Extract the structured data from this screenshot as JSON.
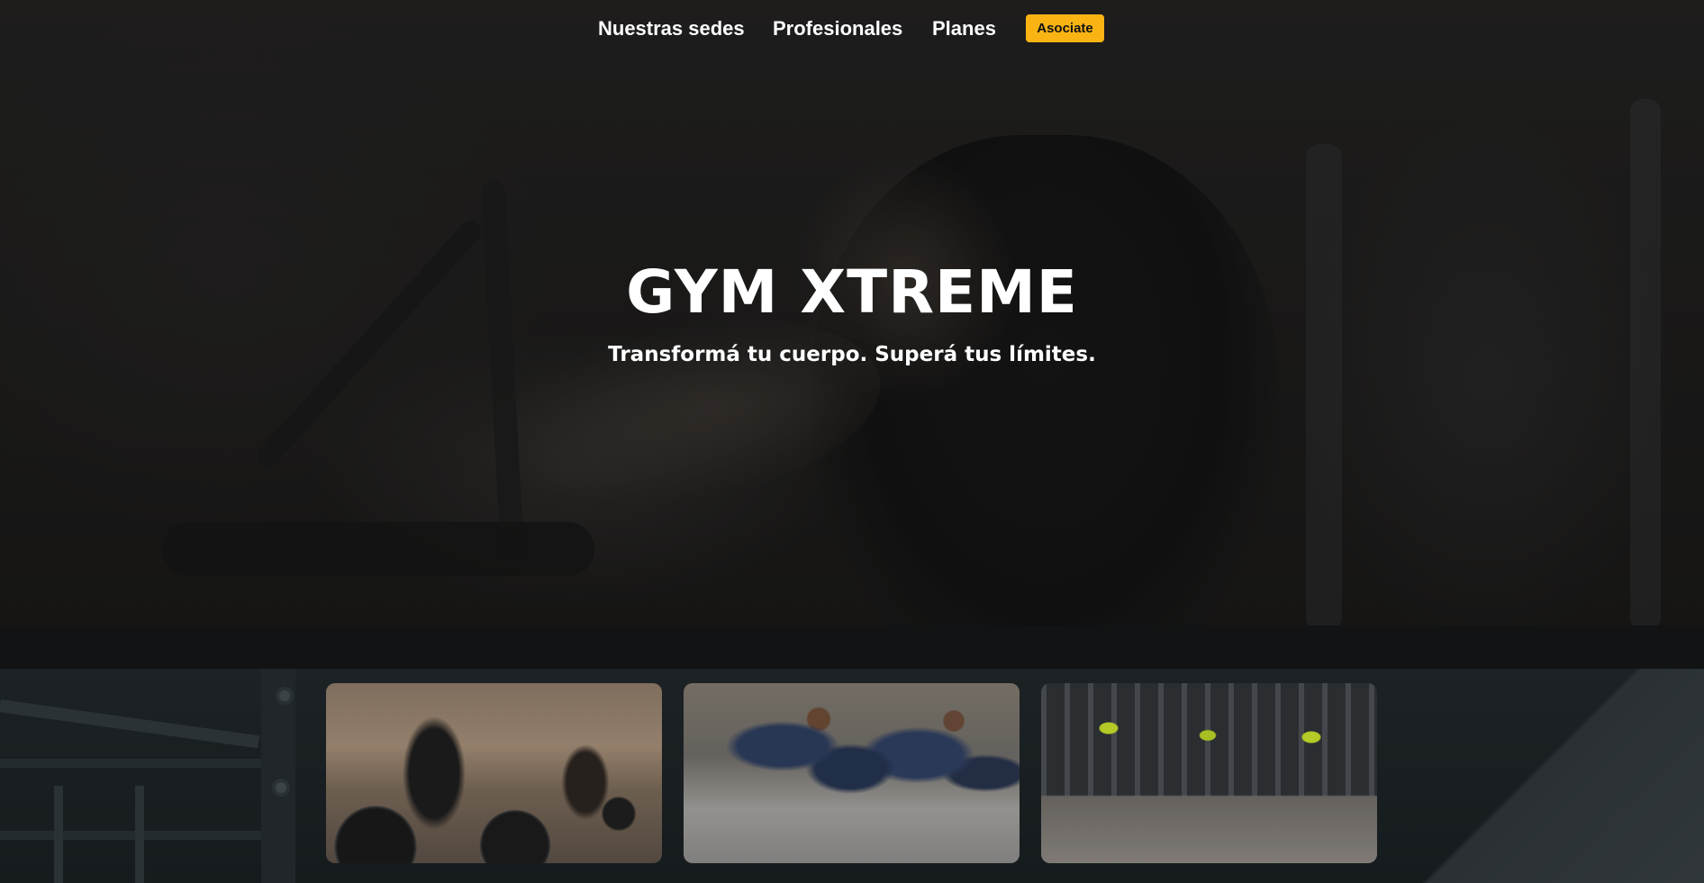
{
  "nav": {
    "links": [
      {
        "label": "Nuestras sedes"
      },
      {
        "label": "Profesionales"
      },
      {
        "label": "Planes"
      }
    ],
    "cta_label": "Asociate"
  },
  "hero": {
    "title": "GYM XTREME",
    "subtitle": "Transformá tu cuerpo. Superá tus límites."
  },
  "gallery": {
    "cards": [
      {
        "image": "deadlift-training-photo"
      },
      {
        "image": "group-plank-row-workout-photo"
      },
      {
        "image": "gym-equipment-room-photo"
      }
    ]
  },
  "colors": {
    "accent": "#f9b414",
    "background": "#111314",
    "text": "#ffffff"
  }
}
